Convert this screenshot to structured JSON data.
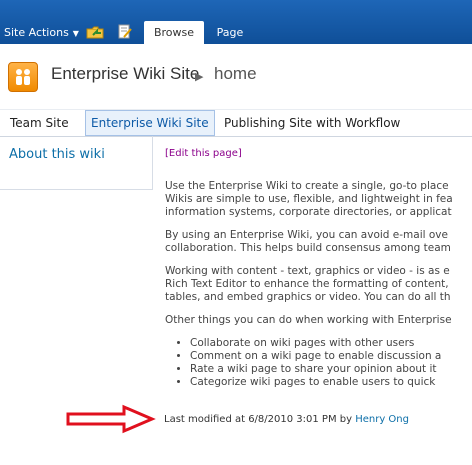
{
  "ribbon": {
    "site_actions": "Site Actions",
    "tabs": [
      "Browse",
      "Page"
    ]
  },
  "header": {
    "site_title": "Enterprise Wiki Site",
    "page_name": "home"
  },
  "topnav": {
    "items": [
      "Team Site",
      "Enterprise Wiki Site",
      "Publishing Site with Workflow"
    ]
  },
  "leftnav": {
    "about": "About this wiki"
  },
  "content": {
    "edit_link": "[Edit this page]",
    "paragraphs": [
      [
        "Use the Enterprise Wiki to create a single, go-to place",
        "Wikis are simple to use, flexible, and lightweight in fea",
        "information systems, corporate directories, or applicat"
      ],
      [
        "By using an Enterprise Wiki, you can avoid e-mail ove",
        "collaboration. This helps build consensus among team"
      ],
      [
        "Working with content - text, graphics or video - is as e",
        "Rich Text Editor to enhance the formatting of content,",
        "tables, and embed graphics or video. You can do all th"
      ],
      [
        "Other things you can do when working with Enterprise"
      ]
    ],
    "bullets": [
      "Collaborate on wiki pages with other users",
      "Comment on a wiki page to enable discussion a",
      "Rate a wiki page to share your opinion about it",
      "Categorize wiki pages to enable users to quick"
    ],
    "modified_prefix": "Last modified at 6/8/2010 3:01 PM by",
    "modified_author": "Henry Ong"
  },
  "colors": {
    "ribbon": "#1e66b7",
    "link": "#0d6fa8",
    "annotation_arrow": "#e0101e"
  }
}
